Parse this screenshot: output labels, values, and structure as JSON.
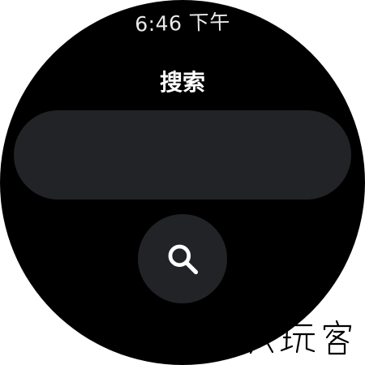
{
  "status": {
    "time": "6:46 下午"
  },
  "screen": {
    "title": "搜索"
  },
  "search": {
    "field_value": "",
    "button_icon": "search-icon"
  },
  "watermark": {
    "text": "大玩客"
  },
  "colors": {
    "background": "#000000",
    "surface": "#222327",
    "text": "#ffffff",
    "icon": "#ffffff"
  }
}
